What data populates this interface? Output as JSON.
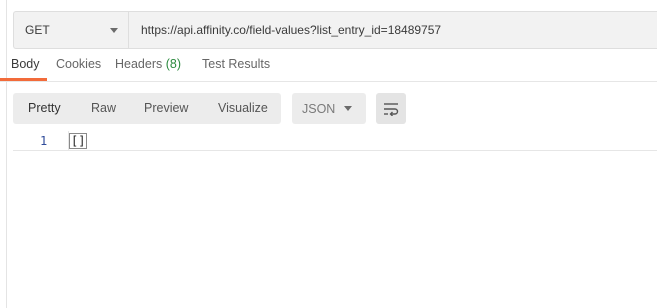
{
  "request": {
    "method": "GET",
    "url": "https://api.affinity.co/field-values?list_entry_id=18489757"
  },
  "tabs": [
    {
      "label": "Body"
    },
    {
      "label": "Cookies"
    },
    {
      "label": "Headers",
      "count": "(8)"
    },
    {
      "label": "Test Results"
    }
  ],
  "active_tab": "Body",
  "toolbar": {
    "views": [
      "Pretty",
      "Raw",
      "Preview",
      "Visualize"
    ],
    "active_view": "Pretty",
    "format": "JSON",
    "wrap_icon": "wrap-lines-icon"
  },
  "response": {
    "lines": [
      {
        "number": "1",
        "text": "[]"
      }
    ]
  },
  "colors": {
    "accent": "#f26b3a",
    "count": "#2b8a3e",
    "line_number": "#2f4b9a"
  }
}
